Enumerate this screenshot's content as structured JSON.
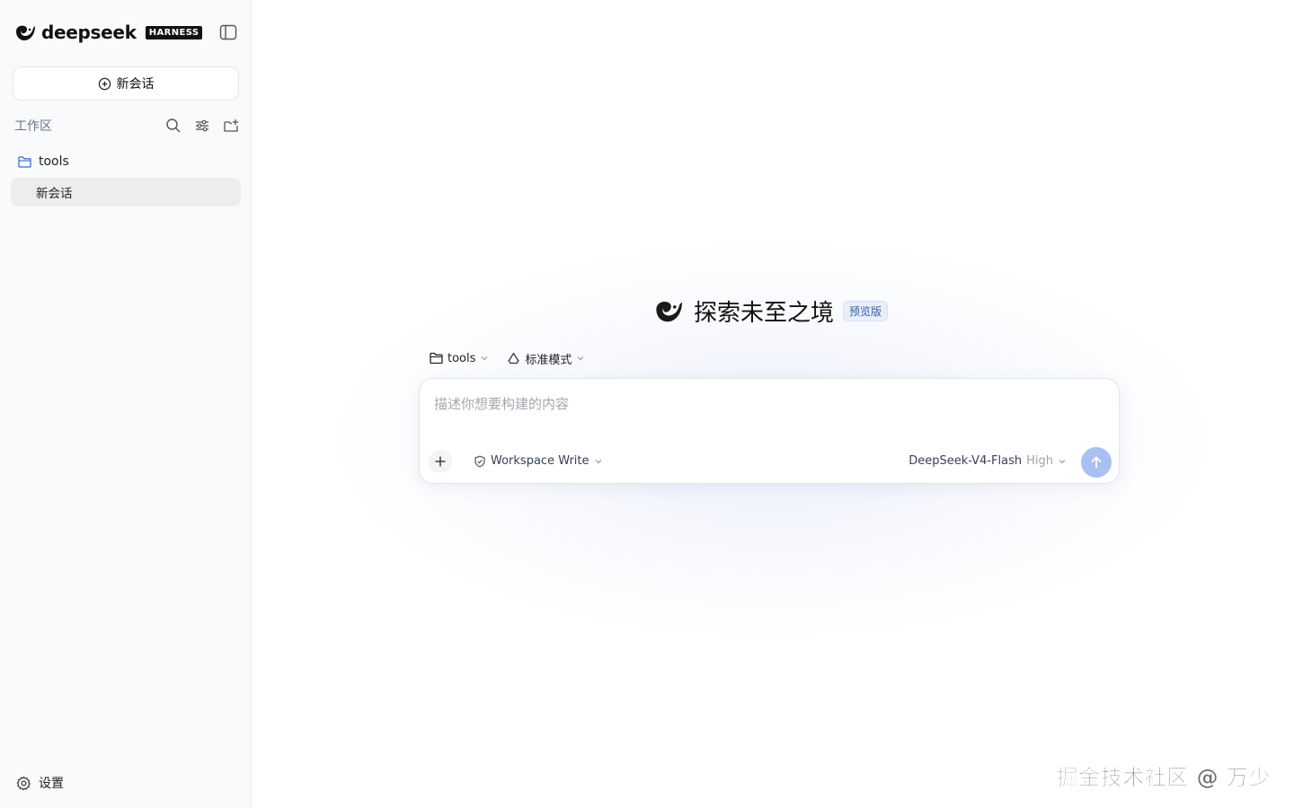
{
  "sidebar": {
    "brand": {
      "name": "deepseek",
      "badge": "HARNESS"
    },
    "new_chat_label": "新会话",
    "workspace": {
      "label": "工作区",
      "folder": "tools",
      "sessions": [
        {
          "label": "新会话",
          "active": true
        }
      ]
    },
    "settings_label": "设置"
  },
  "main": {
    "hero": {
      "title": "探索未至之境",
      "badge": "预览版"
    },
    "selectors": {
      "folder": "tools",
      "mode": "标准模式"
    },
    "composer": {
      "placeholder": "描述你想要构建的内容",
      "permission": "Workspace Write",
      "model": "DeepSeek-V4-Flash",
      "effort": "High"
    }
  },
  "watermark": "掘金技术社区 @ 万少",
  "colors": {
    "sidebar_bg": "#f9fafb",
    "active_session_bg": "#ededee",
    "send_button": "#a8c0f2",
    "folder_icon": "#3b6fd8",
    "brand_blue": "#1f2a44"
  }
}
